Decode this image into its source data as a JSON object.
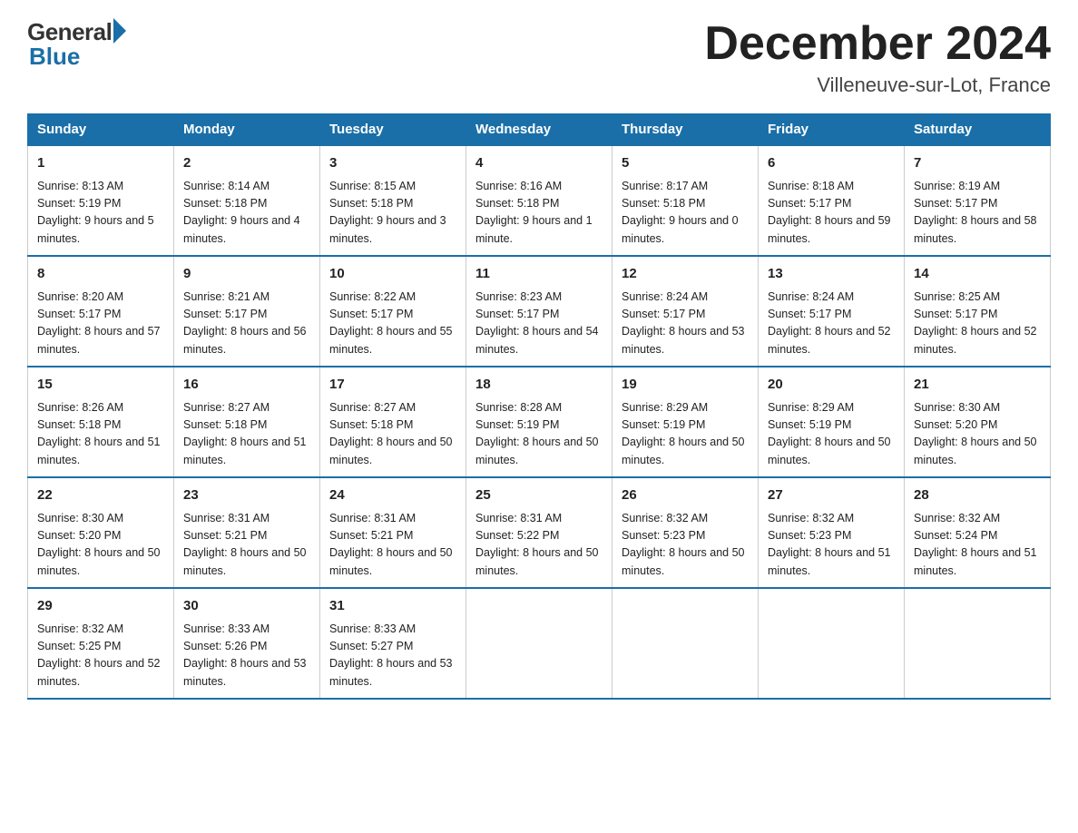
{
  "logo": {
    "general": "General",
    "blue": "Blue"
  },
  "header": {
    "month": "December 2024",
    "location": "Villeneuve-sur-Lot, France"
  },
  "days_of_week": [
    "Sunday",
    "Monday",
    "Tuesday",
    "Wednesday",
    "Thursday",
    "Friday",
    "Saturday"
  ],
  "weeks": [
    [
      {
        "day": "1",
        "sunrise": "Sunrise: 8:13 AM",
        "sunset": "Sunset: 5:19 PM",
        "daylight": "Daylight: 9 hours and 5 minutes."
      },
      {
        "day": "2",
        "sunrise": "Sunrise: 8:14 AM",
        "sunset": "Sunset: 5:18 PM",
        "daylight": "Daylight: 9 hours and 4 minutes."
      },
      {
        "day": "3",
        "sunrise": "Sunrise: 8:15 AM",
        "sunset": "Sunset: 5:18 PM",
        "daylight": "Daylight: 9 hours and 3 minutes."
      },
      {
        "day": "4",
        "sunrise": "Sunrise: 8:16 AM",
        "sunset": "Sunset: 5:18 PM",
        "daylight": "Daylight: 9 hours and 1 minute."
      },
      {
        "day": "5",
        "sunrise": "Sunrise: 8:17 AM",
        "sunset": "Sunset: 5:18 PM",
        "daylight": "Daylight: 9 hours and 0 minutes."
      },
      {
        "day": "6",
        "sunrise": "Sunrise: 8:18 AM",
        "sunset": "Sunset: 5:17 PM",
        "daylight": "Daylight: 8 hours and 59 minutes."
      },
      {
        "day": "7",
        "sunrise": "Sunrise: 8:19 AM",
        "sunset": "Sunset: 5:17 PM",
        "daylight": "Daylight: 8 hours and 58 minutes."
      }
    ],
    [
      {
        "day": "8",
        "sunrise": "Sunrise: 8:20 AM",
        "sunset": "Sunset: 5:17 PM",
        "daylight": "Daylight: 8 hours and 57 minutes."
      },
      {
        "day": "9",
        "sunrise": "Sunrise: 8:21 AM",
        "sunset": "Sunset: 5:17 PM",
        "daylight": "Daylight: 8 hours and 56 minutes."
      },
      {
        "day": "10",
        "sunrise": "Sunrise: 8:22 AM",
        "sunset": "Sunset: 5:17 PM",
        "daylight": "Daylight: 8 hours and 55 minutes."
      },
      {
        "day": "11",
        "sunrise": "Sunrise: 8:23 AM",
        "sunset": "Sunset: 5:17 PM",
        "daylight": "Daylight: 8 hours and 54 minutes."
      },
      {
        "day": "12",
        "sunrise": "Sunrise: 8:24 AM",
        "sunset": "Sunset: 5:17 PM",
        "daylight": "Daylight: 8 hours and 53 minutes."
      },
      {
        "day": "13",
        "sunrise": "Sunrise: 8:24 AM",
        "sunset": "Sunset: 5:17 PM",
        "daylight": "Daylight: 8 hours and 52 minutes."
      },
      {
        "day": "14",
        "sunrise": "Sunrise: 8:25 AM",
        "sunset": "Sunset: 5:17 PM",
        "daylight": "Daylight: 8 hours and 52 minutes."
      }
    ],
    [
      {
        "day": "15",
        "sunrise": "Sunrise: 8:26 AM",
        "sunset": "Sunset: 5:18 PM",
        "daylight": "Daylight: 8 hours and 51 minutes."
      },
      {
        "day": "16",
        "sunrise": "Sunrise: 8:27 AM",
        "sunset": "Sunset: 5:18 PM",
        "daylight": "Daylight: 8 hours and 51 minutes."
      },
      {
        "day": "17",
        "sunrise": "Sunrise: 8:27 AM",
        "sunset": "Sunset: 5:18 PM",
        "daylight": "Daylight: 8 hours and 50 minutes."
      },
      {
        "day": "18",
        "sunrise": "Sunrise: 8:28 AM",
        "sunset": "Sunset: 5:19 PM",
        "daylight": "Daylight: 8 hours and 50 minutes."
      },
      {
        "day": "19",
        "sunrise": "Sunrise: 8:29 AM",
        "sunset": "Sunset: 5:19 PM",
        "daylight": "Daylight: 8 hours and 50 minutes."
      },
      {
        "day": "20",
        "sunrise": "Sunrise: 8:29 AM",
        "sunset": "Sunset: 5:19 PM",
        "daylight": "Daylight: 8 hours and 50 minutes."
      },
      {
        "day": "21",
        "sunrise": "Sunrise: 8:30 AM",
        "sunset": "Sunset: 5:20 PM",
        "daylight": "Daylight: 8 hours and 50 minutes."
      }
    ],
    [
      {
        "day": "22",
        "sunrise": "Sunrise: 8:30 AM",
        "sunset": "Sunset: 5:20 PM",
        "daylight": "Daylight: 8 hours and 50 minutes."
      },
      {
        "day": "23",
        "sunrise": "Sunrise: 8:31 AM",
        "sunset": "Sunset: 5:21 PM",
        "daylight": "Daylight: 8 hours and 50 minutes."
      },
      {
        "day": "24",
        "sunrise": "Sunrise: 8:31 AM",
        "sunset": "Sunset: 5:21 PM",
        "daylight": "Daylight: 8 hours and 50 minutes."
      },
      {
        "day": "25",
        "sunrise": "Sunrise: 8:31 AM",
        "sunset": "Sunset: 5:22 PM",
        "daylight": "Daylight: 8 hours and 50 minutes."
      },
      {
        "day": "26",
        "sunrise": "Sunrise: 8:32 AM",
        "sunset": "Sunset: 5:23 PM",
        "daylight": "Daylight: 8 hours and 50 minutes."
      },
      {
        "day": "27",
        "sunrise": "Sunrise: 8:32 AM",
        "sunset": "Sunset: 5:23 PM",
        "daylight": "Daylight: 8 hours and 51 minutes."
      },
      {
        "day": "28",
        "sunrise": "Sunrise: 8:32 AM",
        "sunset": "Sunset: 5:24 PM",
        "daylight": "Daylight: 8 hours and 51 minutes."
      }
    ],
    [
      {
        "day": "29",
        "sunrise": "Sunrise: 8:32 AM",
        "sunset": "Sunset: 5:25 PM",
        "daylight": "Daylight: 8 hours and 52 minutes."
      },
      {
        "day": "30",
        "sunrise": "Sunrise: 8:33 AM",
        "sunset": "Sunset: 5:26 PM",
        "daylight": "Daylight: 8 hours and 53 minutes."
      },
      {
        "day": "31",
        "sunrise": "Sunrise: 8:33 AM",
        "sunset": "Sunset: 5:27 PM",
        "daylight": "Daylight: 8 hours and 53 minutes."
      },
      null,
      null,
      null,
      null
    ]
  ]
}
